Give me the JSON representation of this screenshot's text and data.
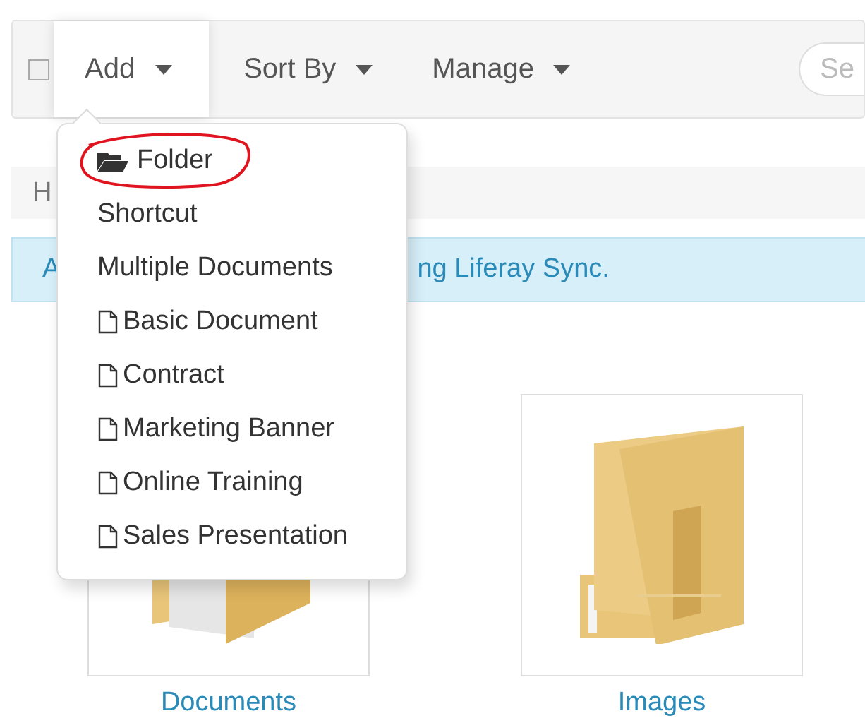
{
  "toolbar": {
    "select_all": {
      "checked": false
    },
    "menus": [
      {
        "label": "Add",
        "selected": true
      },
      {
        "label": "Sort By",
        "selected": false
      },
      {
        "label": "Manage",
        "selected": false
      }
    ],
    "search": {
      "placeholder": "Se"
    }
  },
  "breadcrumb": {
    "text": "H"
  },
  "alert": {
    "parts": [
      "A",
      "ng Liferay Sync."
    ]
  },
  "dropdown": {
    "items": [
      {
        "label": "Folder",
        "kind": "folder",
        "circled": true
      },
      {
        "label": "Shortcut",
        "kind": "plain",
        "circled": false
      },
      {
        "label": "Multiple Documents",
        "kind": "plain",
        "circled": false
      },
      {
        "label": "Basic Document",
        "kind": "document",
        "circled": false
      },
      {
        "label": "Contract",
        "kind": "document",
        "circled": false
      },
      {
        "label": "Marketing Banner",
        "kind": "document",
        "circled": false
      },
      {
        "label": "Online Training",
        "kind": "document",
        "circled": false
      },
      {
        "label": "Sales Presentation",
        "kind": "document",
        "circled": false
      }
    ]
  },
  "folders": [
    {
      "name": "Documents",
      "kind": "documents"
    },
    {
      "name": "Images",
      "kind": "images"
    }
  ]
}
